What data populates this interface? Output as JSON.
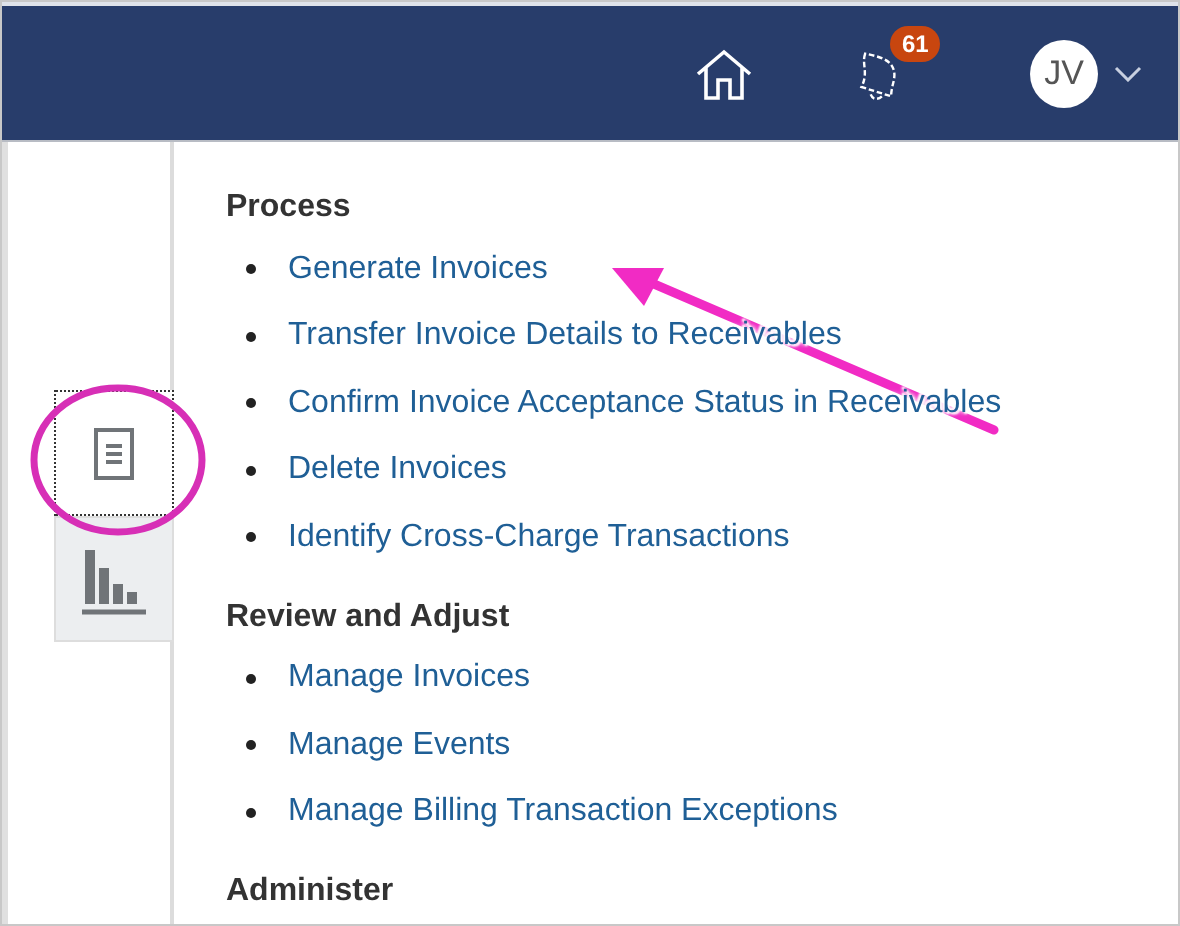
{
  "header": {
    "notification_count": "61",
    "avatar_initials": "JV"
  },
  "sidebar": {
    "items": [
      {
        "kind": "document",
        "selected": true
      },
      {
        "kind": "chart",
        "selected": false
      }
    ]
  },
  "sections": [
    {
      "title": "Process",
      "links": [
        "Generate Invoices",
        "Transfer Invoice Details to Receivables",
        "Confirm Invoice Acceptance Status in Receivables",
        "Delete Invoices",
        "Identify Cross-Charge Transactions"
      ]
    },
    {
      "title": "Review and Adjust",
      "links": [
        "Manage Invoices",
        "Manage Events",
        "Manage Billing Transaction Exceptions"
      ]
    },
    {
      "title": "Administer"
    }
  ]
}
